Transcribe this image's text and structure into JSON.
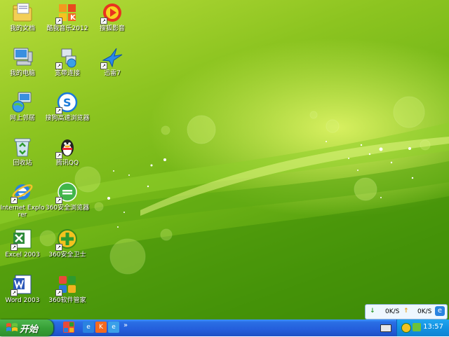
{
  "desktop_icons": [
    {
      "label": "我的文档"
    },
    {
      "label": "酷我音乐2012"
    },
    {
      "label": "搜狐影音"
    },
    {
      "label": "我的电脑"
    },
    {
      "label": "宽带连接"
    },
    {
      "label": "迅雷7"
    },
    {
      "label": "网上邻居"
    },
    {
      "label": "搜狗高速浏览器"
    },
    {
      "label": "回收站"
    },
    {
      "label": "腾讯QQ"
    },
    {
      "label": "Internet Explorer"
    },
    {
      "label": "360安全浏览器"
    },
    {
      "label": "Excel 2003"
    },
    {
      "label": "360安全卫士"
    },
    {
      "label": "Word 2003"
    },
    {
      "label": "360软件管家"
    }
  ],
  "speed_widget": {
    "download": "0K/S",
    "upload": "0K/S"
  },
  "taskbar": {
    "start_label": "开始",
    "chevron": "»",
    "clock": "13:57"
  },
  "colors": {
    "taskbar": "#245edb",
    "start": "#37a137",
    "tray": "#1292e1",
    "wallpaper": "#6fb416"
  }
}
